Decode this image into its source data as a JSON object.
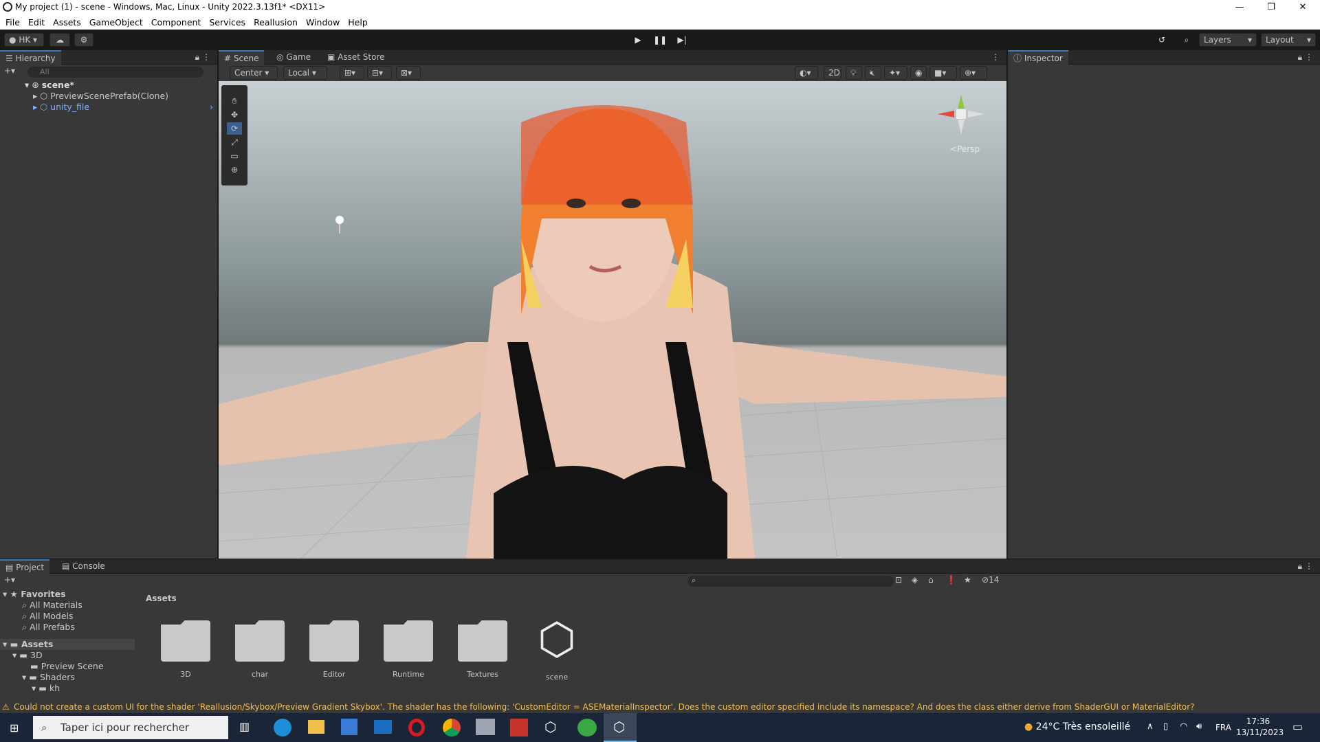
{
  "window": {
    "title": "My project (1) - scene - Windows, Mac, Linux - Unity 2022.3.13f1* <DX11>"
  },
  "menu": [
    "File",
    "Edit",
    "Assets",
    "GameObject",
    "Component",
    "Services",
    "Reallusion",
    "Window",
    "Help"
  ],
  "toolbar": {
    "account": "HK",
    "layers": "Layers",
    "layout": "Layout"
  },
  "hierarchy": {
    "tab": "Hierarchy",
    "search_placeholder": "All",
    "items": [
      {
        "label": "scene*"
      },
      {
        "label": "PreviewScenePrefab(Clone)"
      },
      {
        "label": "unity_file"
      }
    ]
  },
  "scene": {
    "tabs": [
      "Scene",
      "Game",
      "Asset Store"
    ],
    "pivot": "Center",
    "space": "Local",
    "mode2d": "2D",
    "persp": "<Persp"
  },
  "inspector": {
    "tab": "Inspector"
  },
  "project": {
    "tabs": [
      "Project",
      "Console"
    ],
    "count": "14",
    "favorites_title": "Favorites",
    "favorites": [
      "All Materials",
      "All Models",
      "All Prefabs"
    ],
    "assets_title": "Assets",
    "tree": [
      "3D",
      "Preview Scene",
      "Shaders",
      "kh"
    ],
    "breadcrumb": "Assets",
    "grid": [
      {
        "name": "3D",
        "kind": "folder"
      },
      {
        "name": "char",
        "kind": "folder"
      },
      {
        "name": "Editor",
        "kind": "folder"
      },
      {
        "name": "Runtime",
        "kind": "folder"
      },
      {
        "name": "Textures",
        "kind": "folder"
      },
      {
        "name": "scene",
        "kind": "unity-scene"
      }
    ]
  },
  "status": {
    "message": "Could not create a custom UI for the shader 'Reallusion/Skybox/Preview Gradient Skybox'. The shader has the following: 'CustomEditor = ASEMaterialInspector'. Does the custom editor specified include its namespace? And does the class either derive from ShaderGUI or MaterialEditor?"
  },
  "taskbar": {
    "search_placeholder": "Taper ici pour rechercher",
    "weather": "24°C  Très ensoleillé",
    "lang": "FRA",
    "time": "17:36",
    "date": "13/11/2023"
  }
}
